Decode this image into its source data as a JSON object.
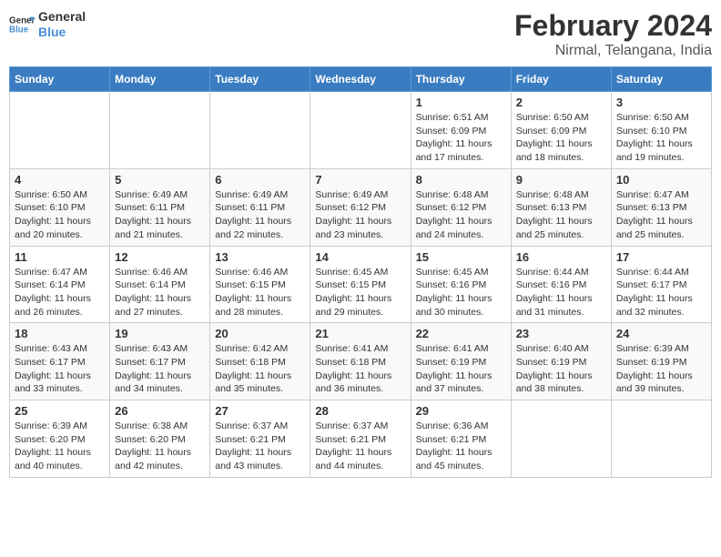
{
  "header": {
    "logo_line1": "General",
    "logo_line2": "Blue",
    "title": "February 2024",
    "subtitle": "Nirmal, Telangana, India"
  },
  "days_of_week": [
    "Sunday",
    "Monday",
    "Tuesday",
    "Wednesday",
    "Thursday",
    "Friday",
    "Saturday"
  ],
  "weeks": [
    [
      {
        "day": "",
        "info": ""
      },
      {
        "day": "",
        "info": ""
      },
      {
        "day": "",
        "info": ""
      },
      {
        "day": "",
        "info": ""
      },
      {
        "day": "1",
        "info": "Sunrise: 6:51 AM\nSunset: 6:09 PM\nDaylight: 11 hours and 17 minutes."
      },
      {
        "day": "2",
        "info": "Sunrise: 6:50 AM\nSunset: 6:09 PM\nDaylight: 11 hours and 18 minutes."
      },
      {
        "day": "3",
        "info": "Sunrise: 6:50 AM\nSunset: 6:10 PM\nDaylight: 11 hours and 19 minutes."
      }
    ],
    [
      {
        "day": "4",
        "info": "Sunrise: 6:50 AM\nSunset: 6:10 PM\nDaylight: 11 hours and 20 minutes."
      },
      {
        "day": "5",
        "info": "Sunrise: 6:49 AM\nSunset: 6:11 PM\nDaylight: 11 hours and 21 minutes."
      },
      {
        "day": "6",
        "info": "Sunrise: 6:49 AM\nSunset: 6:11 PM\nDaylight: 11 hours and 22 minutes."
      },
      {
        "day": "7",
        "info": "Sunrise: 6:49 AM\nSunset: 6:12 PM\nDaylight: 11 hours and 23 minutes."
      },
      {
        "day": "8",
        "info": "Sunrise: 6:48 AM\nSunset: 6:12 PM\nDaylight: 11 hours and 24 minutes."
      },
      {
        "day": "9",
        "info": "Sunrise: 6:48 AM\nSunset: 6:13 PM\nDaylight: 11 hours and 25 minutes."
      },
      {
        "day": "10",
        "info": "Sunrise: 6:47 AM\nSunset: 6:13 PM\nDaylight: 11 hours and 25 minutes."
      }
    ],
    [
      {
        "day": "11",
        "info": "Sunrise: 6:47 AM\nSunset: 6:14 PM\nDaylight: 11 hours and 26 minutes."
      },
      {
        "day": "12",
        "info": "Sunrise: 6:46 AM\nSunset: 6:14 PM\nDaylight: 11 hours and 27 minutes."
      },
      {
        "day": "13",
        "info": "Sunrise: 6:46 AM\nSunset: 6:15 PM\nDaylight: 11 hours and 28 minutes."
      },
      {
        "day": "14",
        "info": "Sunrise: 6:45 AM\nSunset: 6:15 PM\nDaylight: 11 hours and 29 minutes."
      },
      {
        "day": "15",
        "info": "Sunrise: 6:45 AM\nSunset: 6:16 PM\nDaylight: 11 hours and 30 minutes."
      },
      {
        "day": "16",
        "info": "Sunrise: 6:44 AM\nSunset: 6:16 PM\nDaylight: 11 hours and 31 minutes."
      },
      {
        "day": "17",
        "info": "Sunrise: 6:44 AM\nSunset: 6:17 PM\nDaylight: 11 hours and 32 minutes."
      }
    ],
    [
      {
        "day": "18",
        "info": "Sunrise: 6:43 AM\nSunset: 6:17 PM\nDaylight: 11 hours and 33 minutes."
      },
      {
        "day": "19",
        "info": "Sunrise: 6:43 AM\nSunset: 6:17 PM\nDaylight: 11 hours and 34 minutes."
      },
      {
        "day": "20",
        "info": "Sunrise: 6:42 AM\nSunset: 6:18 PM\nDaylight: 11 hours and 35 minutes."
      },
      {
        "day": "21",
        "info": "Sunrise: 6:41 AM\nSunset: 6:18 PM\nDaylight: 11 hours and 36 minutes."
      },
      {
        "day": "22",
        "info": "Sunrise: 6:41 AM\nSunset: 6:19 PM\nDaylight: 11 hours and 37 minutes."
      },
      {
        "day": "23",
        "info": "Sunrise: 6:40 AM\nSunset: 6:19 PM\nDaylight: 11 hours and 38 minutes."
      },
      {
        "day": "24",
        "info": "Sunrise: 6:39 AM\nSunset: 6:19 PM\nDaylight: 11 hours and 39 minutes."
      }
    ],
    [
      {
        "day": "25",
        "info": "Sunrise: 6:39 AM\nSunset: 6:20 PM\nDaylight: 11 hours and 40 minutes."
      },
      {
        "day": "26",
        "info": "Sunrise: 6:38 AM\nSunset: 6:20 PM\nDaylight: 11 hours and 42 minutes."
      },
      {
        "day": "27",
        "info": "Sunrise: 6:37 AM\nSunset: 6:21 PM\nDaylight: 11 hours and 43 minutes."
      },
      {
        "day": "28",
        "info": "Sunrise: 6:37 AM\nSunset: 6:21 PM\nDaylight: 11 hours and 44 minutes."
      },
      {
        "day": "29",
        "info": "Sunrise: 6:36 AM\nSunset: 6:21 PM\nDaylight: 11 hours and 45 minutes."
      },
      {
        "day": "",
        "info": ""
      },
      {
        "day": "",
        "info": ""
      }
    ]
  ]
}
